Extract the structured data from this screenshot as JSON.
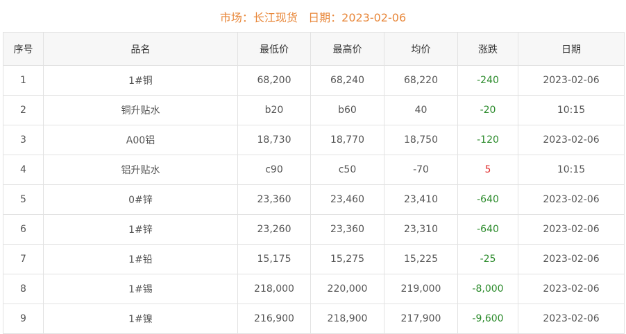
{
  "header": {
    "title": "市场：长江现货   日期：2023-02-06"
  },
  "table": {
    "columns": [
      "序号",
      "品名",
      "最低价",
      "最高价",
      "均价",
      "涨跌",
      "日期"
    ],
    "rows": [
      [
        "1",
        "1#铜",
        "68,200",
        "68,240",
        "68,220",
        "-240",
        "2023-02-06"
      ],
      [
        "2",
        "铜升贴水",
        "b20",
        "b60",
        "40",
        "-20",
        "10:15"
      ],
      [
        "3",
        "A00铝",
        "18,730",
        "18,770",
        "18,750",
        "-120",
        "2023-02-06"
      ],
      [
        "4",
        "铝升贴水",
        "c90",
        "c50",
        "-70",
        "5",
        "10:15"
      ],
      [
        "5",
        "0#锌",
        "23,360",
        "23,460",
        "23,410",
        "-640",
        "2023-02-06"
      ],
      [
        "6",
        "1#锌",
        "23,260",
        "23,360",
        "23,310",
        "-640",
        "2023-02-06"
      ],
      [
        "7",
        "1#铅",
        "15,175",
        "15,275",
        "15,225",
        "-25",
        "2023-02-06"
      ],
      [
        "8",
        "1#锡",
        "218,000",
        "220,000",
        "219,000",
        "-8,000",
        "2023-02-06"
      ],
      [
        "9",
        "1#镍",
        "216,900",
        "218,900",
        "217,900",
        "-9,600",
        "2023-02-06"
      ]
    ]
  },
  "colors": {
    "title": "#e8873a",
    "decrease": "#2a8a2a",
    "increase": "#e03030",
    "header_bg": "#f7f7f7",
    "border": "#e2e2e2"
  }
}
